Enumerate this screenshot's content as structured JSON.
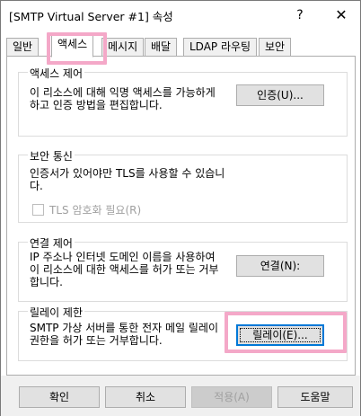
{
  "window": {
    "title": "[SMTP Virtual Server #1] 속성",
    "help_icon": "question-icon",
    "help_label": "?",
    "close_icon": "close-icon",
    "close_label": "✕"
  },
  "tabs": [
    {
      "label": "일반"
    },
    {
      "label": "액세스",
      "active": true
    },
    {
      "label": "메시지"
    },
    {
      "label": "배달"
    },
    {
      "label": "LDAP 라우팅"
    },
    {
      "label": "보안"
    }
  ],
  "groups": {
    "access_control": {
      "title": "액세스 제어",
      "text": "이 리소스에 대해 익명 액세스를 가능하게\n하고 인증 방법을 편집합니다.",
      "button": "인증(U)..."
    },
    "secure_communication": {
      "title": "보안 통신",
      "text": "인증서가 있어야만 TLS를 사용할 수 있습니\n다.",
      "checkbox_label": "TLS 암호화 필요(R)",
      "checkbox_checked": false
    },
    "connection_control": {
      "title": "연결 제어",
      "text": "IP 주소나 인터넷 도메인 이름을 사용하여\n이 리소스에 대한 액세스를 허가 또는 거부\n합니다.",
      "button": "연결(N):"
    },
    "relay_restrictions": {
      "title": "릴레이 제한",
      "text": "SMTP 가상 서버를 통한 전자 메일 릴레이\n권한을 허가 또는 거부합니다.",
      "button": "릴레이(E)..."
    }
  },
  "footer": {
    "ok": "확인",
    "cancel": "취소",
    "apply": "적용(A)",
    "help": "도움말"
  },
  "highlight_color": "#f4a8c8"
}
